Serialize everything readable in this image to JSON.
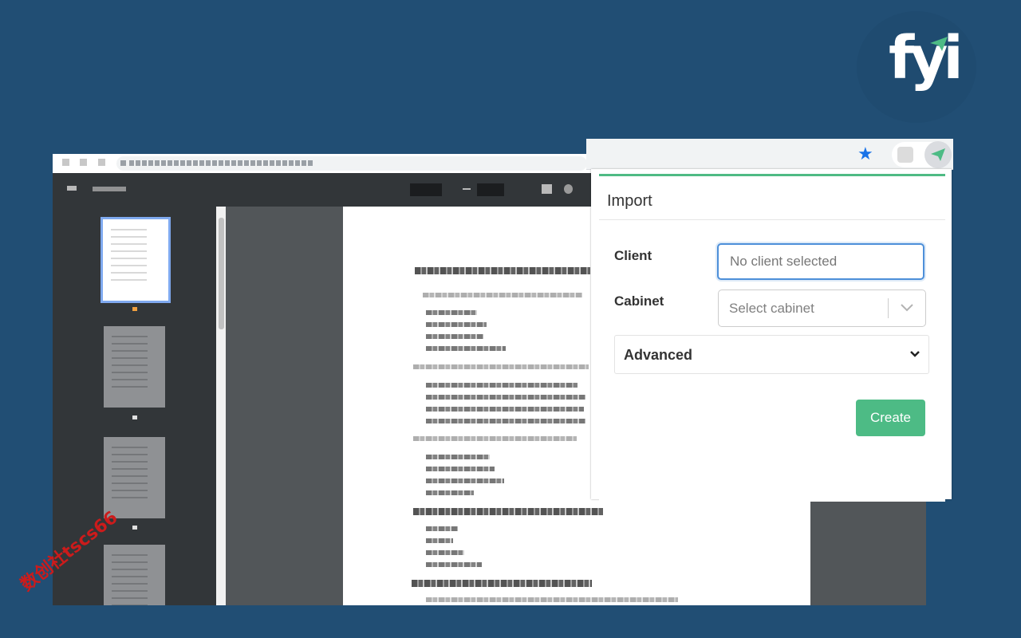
{
  "brand": {
    "logo_text": "fyi",
    "accent_color": "#4dbb85",
    "background_color": "#214e74"
  },
  "browser": {
    "icons": [
      "back-arrow-icon",
      "forward-arrow-icon",
      "reload-icon",
      "lock-icon"
    ]
  },
  "extension_bar": {
    "bookmark_icon": "star-icon",
    "extension_icons": [
      "puzzle-extension-icon",
      "paper-plane-icon"
    ]
  },
  "popup": {
    "title": "Import",
    "client_label": "Client",
    "client_placeholder": "No client selected",
    "cabinet_label": "Cabinet",
    "cabinet_placeholder": "Select cabinet",
    "advanced_label": "Advanced",
    "create_label": "Create"
  },
  "watermark": {
    "text": "数创社tscs66"
  }
}
